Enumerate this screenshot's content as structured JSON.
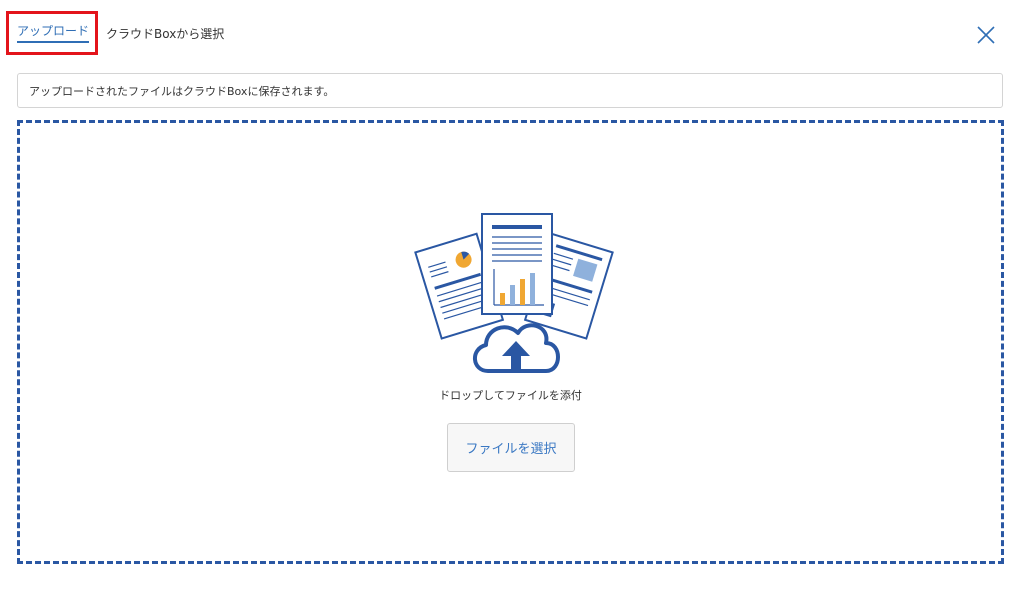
{
  "tabs": {
    "upload_label": "アップロード",
    "cloud_box_label": "クラウドBoxから選択"
  },
  "close": {
    "icon": "close-icon"
  },
  "notice": {
    "text": "アップロードされたファイルはクラウドBoxに保存されます。"
  },
  "dropzone": {
    "illustration_icon": "documents-cloud-upload-icon",
    "drop_text": "ドロップしてファイルを添付",
    "select_button_label": "ファイルを選択"
  },
  "colors": {
    "accent": "#2f6eb5",
    "highlight": "#e3141b",
    "dropzone_border": "#2a57a3",
    "chart_orange": "#f0a732",
    "chart_blue": "#8fb1dc"
  }
}
